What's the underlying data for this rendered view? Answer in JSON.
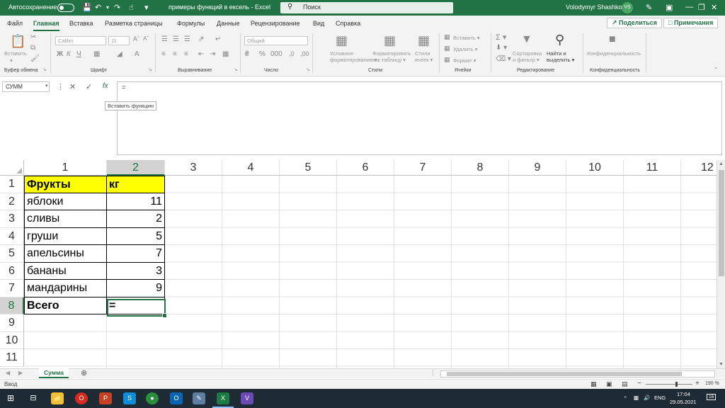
{
  "titlebar": {
    "autosave_label": "Автосохранение",
    "doc_title": "примеры функций в ексель  -  Excel",
    "search_placeholder": "Поиск",
    "user_name": "Volodymyr Shashkov",
    "user_initials": "VS"
  },
  "tabs": [
    "Файл",
    "Главная",
    "Вставка",
    "Разметка страницы",
    "Формулы",
    "Данные",
    "Рецензирование",
    "Вид",
    "Справка"
  ],
  "active_tab": "Главная",
  "share_label": "Поделиться",
  "comments_label": "Примечания",
  "ribbon": {
    "paste_label": "Вставить",
    "clipboard_group": "Буфер обмена",
    "font_name": "Calibri",
    "font_size": "11",
    "font_group": "Шрифт",
    "alignment_group": "Выравнивание",
    "number_format": "Общий",
    "number_group": "Число",
    "cond_format_label_1": "Условное",
    "cond_format_label_2": "форматирование",
    "format_table_label_1": "Форматировать",
    "format_table_label_2": "как таблицу",
    "cell_styles_label_1": "Стили",
    "cell_styles_label_2": "ячеек",
    "styles_group": "Стили",
    "insert_label": "Вставить",
    "delete_label": "Удалить",
    "format_label": "Формат",
    "cells_group": "Ячейки",
    "sort_label_1": "Сортировка",
    "sort_label_2": "и фильтр",
    "find_label_1": "Найти и",
    "find_label_2": "выделить",
    "editing_group": "Редактирование",
    "sensitivity_label": "Конфиденциальность",
    "sensitivity_group": "Конфиденциальность"
  },
  "formula_bar": {
    "name_box": "СУММ",
    "formula": "=",
    "fx_label": "fx",
    "tooltip": "Вставить функцию"
  },
  "grid": {
    "columns": [
      "1",
      "2",
      "3",
      "4",
      "5",
      "6",
      "7",
      "8",
      "9",
      "10",
      "11",
      "12"
    ],
    "rows": [
      "1",
      "2",
      "3",
      "4",
      "5",
      "6",
      "7",
      "8",
      "9",
      "10",
      "11"
    ],
    "header": {
      "col_a": "Фрукты",
      "col_b": "кг"
    },
    "data": [
      {
        "fruit": "яблоки",
        "kg": "11"
      },
      {
        "fruit": "сливы",
        "kg": "2"
      },
      {
        "fruit": "груши",
        "kg": "5"
      },
      {
        "fruit": "апельсины",
        "kg": "7"
      },
      {
        "fruit": "бананы",
        "kg": "3"
      },
      {
        "fruit": "мандарины",
        "kg": "9"
      }
    ],
    "total_label": "Всего",
    "total_value": "="
  },
  "sheet_tab": "Сумма",
  "status": {
    "mode": "Ввод",
    "zoom": "190 %"
  },
  "taskbar": {
    "lang": "ENG",
    "time": "17:04",
    "date": "29.05.2021",
    "notifications": "16"
  }
}
